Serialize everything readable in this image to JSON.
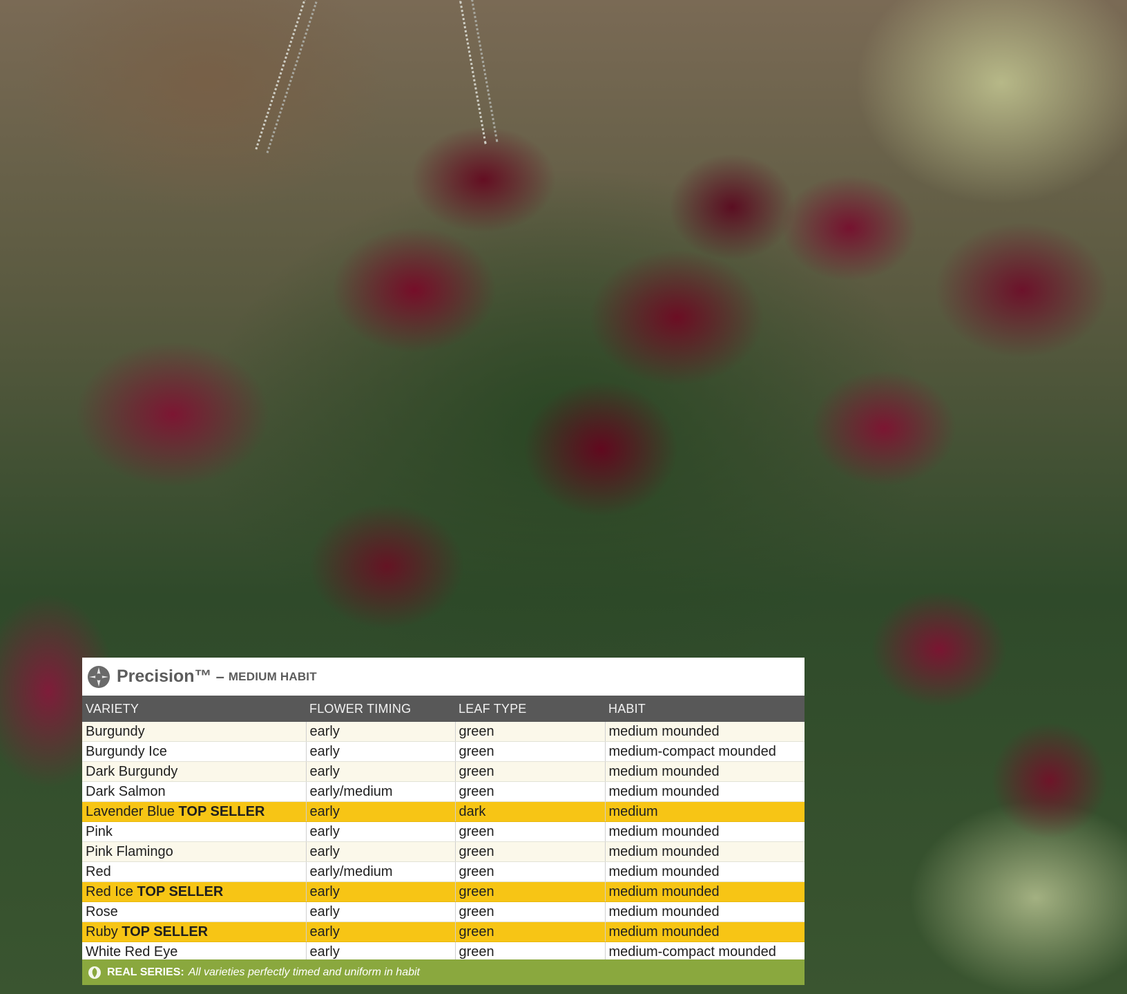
{
  "header": {
    "brand": "Precision™",
    "dash": "–",
    "subtitle": "MEDIUM HABIT"
  },
  "table": {
    "columns": [
      "VARIETY",
      "FLOWER TIMING",
      "LEAF TYPE",
      "HABIT"
    ],
    "rows": [
      {
        "variety": "Burgundy",
        "tag": "",
        "timing": "early",
        "leaf": "green",
        "habit": "medium mounded",
        "highlight": false
      },
      {
        "variety": "Burgundy Ice",
        "tag": "",
        "timing": "early",
        "leaf": "green",
        "habit": "medium-compact mounded",
        "highlight": false
      },
      {
        "variety": "Dark Burgundy",
        "tag": "",
        "timing": "early",
        "leaf": "green",
        "habit": "medium mounded",
        "highlight": false
      },
      {
        "variety": "Dark Salmon",
        "tag": "",
        "timing": "early/medium",
        "leaf": "green",
        "habit": "medium mounded",
        "highlight": false
      },
      {
        "variety": "Lavender Blue",
        "tag": "TOP SELLER",
        "timing": "early",
        "leaf": "dark",
        "habit": "medium",
        "highlight": true
      },
      {
        "variety": "Pink",
        "tag": "",
        "timing": "early",
        "leaf": "green",
        "habit": "medium mounded",
        "highlight": false
      },
      {
        "variety": "Pink Flamingo",
        "tag": "",
        "timing": "early",
        "leaf": "green",
        "habit": "medium mounded",
        "highlight": false
      },
      {
        "variety": "Red",
        "tag": "",
        "timing": "early/medium",
        "leaf": "green",
        "habit": "medium mounded",
        "highlight": false
      },
      {
        "variety": "Red Ice",
        "tag": "TOP SELLER",
        "timing": "early",
        "leaf": "green",
        "habit": "medium mounded",
        "highlight": true
      },
      {
        "variety": "Rose",
        "tag": "",
        "timing": "early",
        "leaf": "green",
        "habit": "medium mounded",
        "highlight": false
      },
      {
        "variety": "Ruby",
        "tag": "TOP SELLER",
        "timing": "early",
        "leaf": "green",
        "habit": "medium mounded",
        "highlight": true
      },
      {
        "variety": "White Red Eye",
        "tag": "",
        "timing": "early",
        "leaf": "green",
        "habit": "medium-compact mounded",
        "highlight": false
      }
    ]
  },
  "footer": {
    "label": "REAL SERIES:",
    "text": "All varieties perfectly timed and uniform in habit"
  },
  "colors": {
    "highlight": "#f7c515",
    "header_bar": "#585858",
    "footer_bar": "#8aa83e"
  },
  "icons": {
    "brand": "precision-logo-icon",
    "footer": "recycle-leaf-icon"
  }
}
